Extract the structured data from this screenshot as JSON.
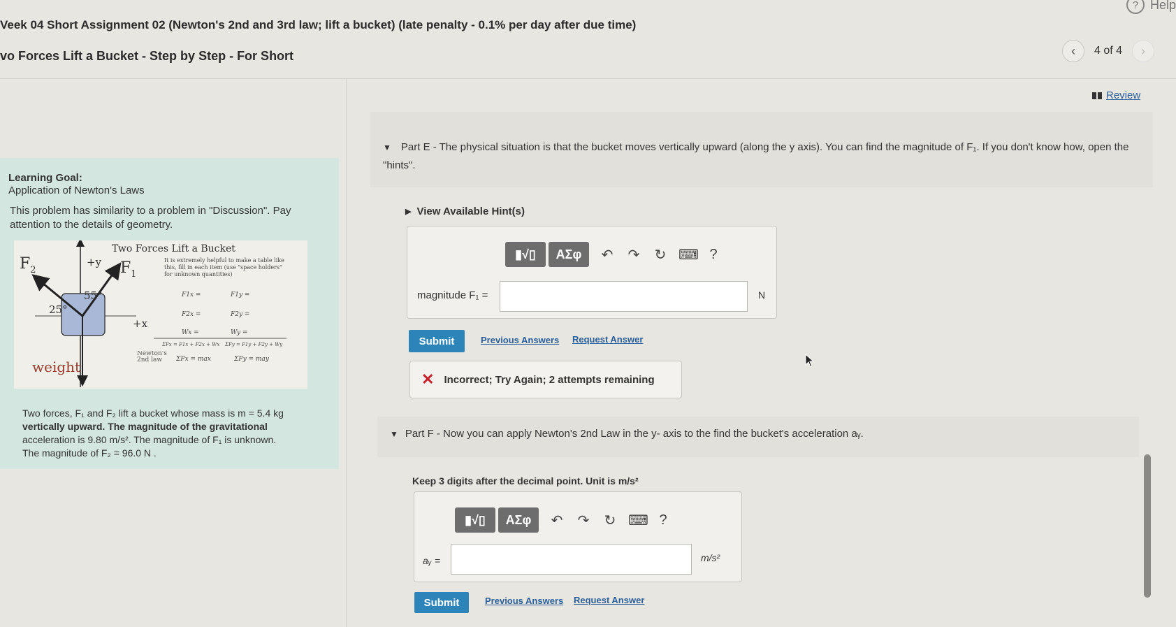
{
  "header": {
    "assignment_title": "Veek 04 Short Assignment 02 (Newton's 2nd and 3rd law; lift a bucket) (late penalty - 0.1% per day after due time)",
    "problem_title": "vo Forces Lift a Bucket - Step by Step - For Short",
    "help_label": "Help",
    "page_counter": "4 of 4",
    "review_label": "Review"
  },
  "learning_goal": {
    "title": "Learning Goal:",
    "subtitle": "Application of Newton's Laws",
    "text": "This problem has similarity to a problem in \"Discussion\". Pay attention to the details of geometry."
  },
  "figure": {
    "title": "Two Forces Lift a Bucket",
    "label_f2": "F",
    "label_f2_sub": "2",
    "label_f1": "F",
    "label_f1_sub": "1",
    "label_plus_y": "+y",
    "label_plus_x": "+x",
    "label_angle_25": "25°",
    "label_angle_55": "55°",
    "label_weight": "weight",
    "note": "It is extremely helpful to make a table like this, fill in each item (use \"space holders\" for unknown quantities)",
    "table": [
      [
        "F1x =",
        "F1y ="
      ],
      [
        "F2x =",
        "F2y ="
      ],
      [
        "Wx =",
        "Wy ="
      ],
      [
        "ΣFx = F1x + F2x + Wx",
        "ΣFy = F1y + F2y + Wy"
      ]
    ],
    "newton_label": "Newton's 2nd law",
    "newton_x": "ΣFx = max",
    "newton_y": "ΣFy = may"
  },
  "problem": {
    "line1": "Two forces, F₁ and F₂ lift a bucket whose mass is m = 5.4 kg",
    "line2": "vertically upward. The magnitude of the gravitational",
    "line3": "acceleration is 9.80 m/s². The magnitude of F₁ is unknown.",
    "line4": "The magnitude of F₂ = 96.0 N ."
  },
  "partE": {
    "text": "Part E - The physical situation is that the bucket moves vertically upward (along the y axis). You can find the magnitude of F₁. If you don't know how, open the \"hints\".",
    "hints_label": "View Available Hint(s)",
    "input_label": "magnitude F₁ =",
    "input_value": "",
    "unit": "N",
    "submit_label": "Submit",
    "previous_answers": "Previous Answers",
    "request_answer": "Request Answer",
    "feedback": "Incorrect; Try Again; 2 attempts remaining"
  },
  "partF": {
    "text": "Part F - Now you can apply Newton's 2nd Law in the y- axis to the find the bucket's acceleration aᵧ.",
    "instruction": "Keep 3 digits after the decimal point. Unit is m/s²",
    "input_label": "aᵧ =",
    "input_value": "",
    "unit": "m/s²",
    "submit_label": "Submit",
    "previous_answers": "Previous Answers",
    "request_answer": "Request Answer"
  },
  "toolbar": {
    "templates_label": "▮√▯",
    "greek_label": "ΑΣφ",
    "help_symbol": "?"
  },
  "colors": {
    "submit": "#2d84b8",
    "goal_panel": "#d4e6e0",
    "error": "#c7202a",
    "link": "#2b5f9a"
  }
}
